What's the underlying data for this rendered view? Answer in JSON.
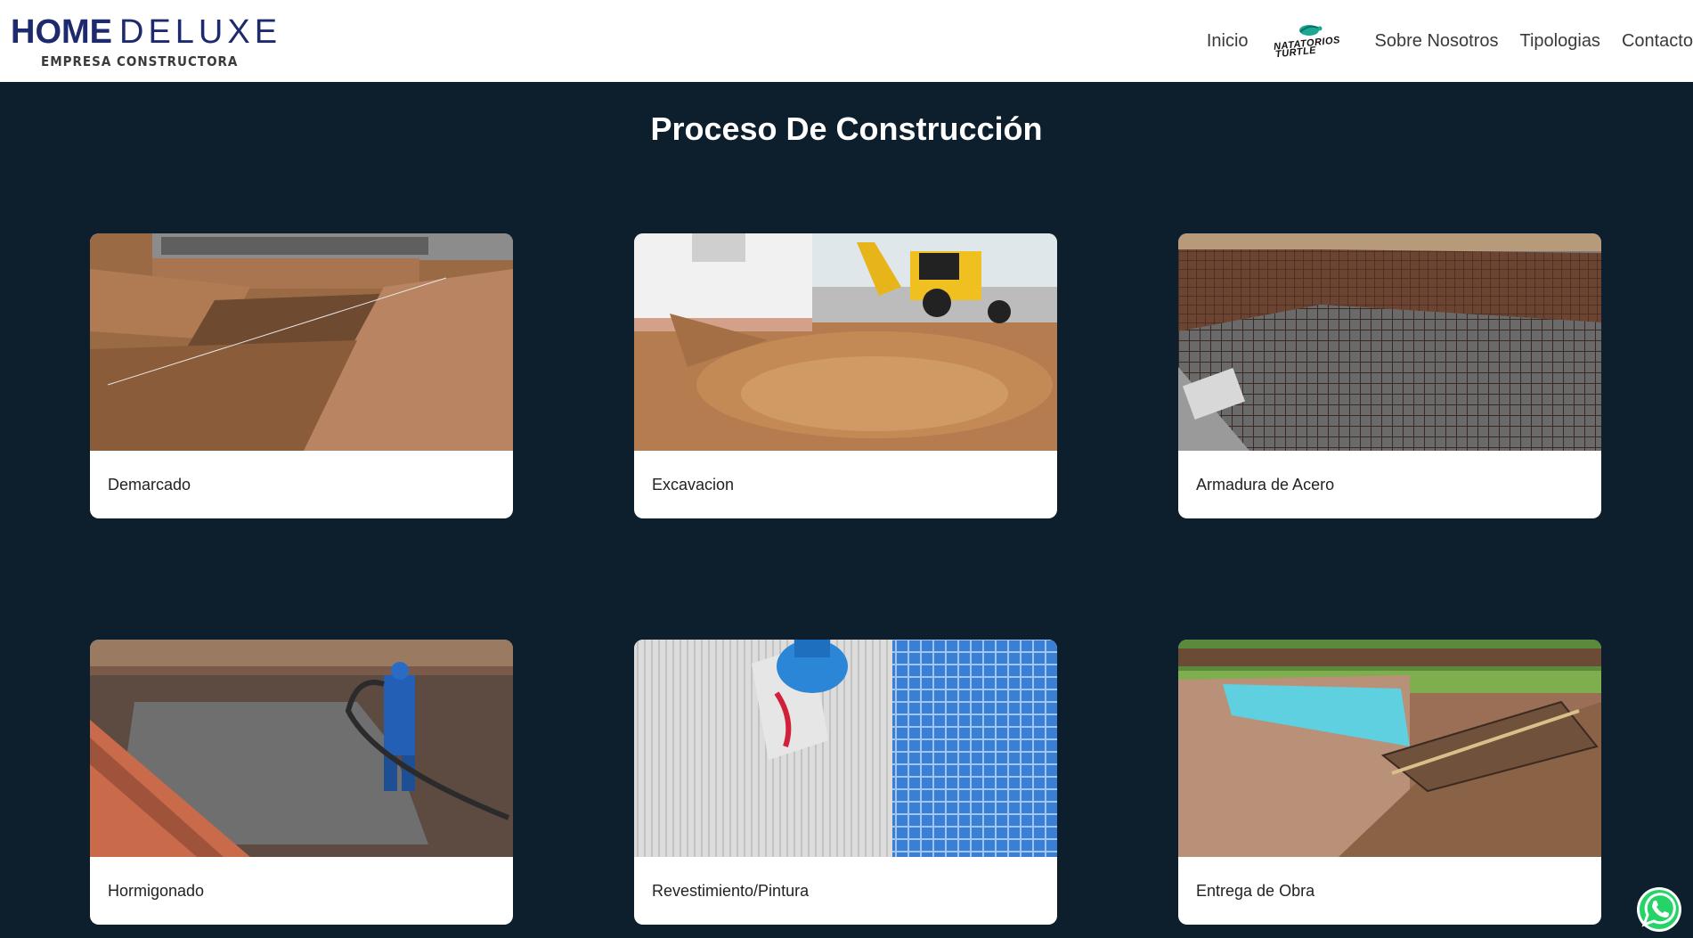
{
  "brand": {
    "logo_main_bold": "HOME",
    "logo_main_light": "DELUXE",
    "logo_sub": "EMPRESA CONSTRUCTORA"
  },
  "nav": {
    "inicio": "Inicio",
    "partner_line1": "NATATORIOS",
    "partner_line2": "TURTLE",
    "sobre": "Sobre Nosotros",
    "tipologias": "Tipologias",
    "contacto": "Contacto"
  },
  "section": {
    "title": "Proceso De Construcción"
  },
  "cards": [
    {
      "label": "Demarcado"
    },
    {
      "label": "Excavacion"
    },
    {
      "label": "Armadura de Acero"
    },
    {
      "label": "Hormigonado"
    },
    {
      "label": "Revestimiento/Pintura"
    },
    {
      "label": "Entrega de Obra"
    }
  ],
  "colors": {
    "background": "#0d1f2d",
    "navbar": "#ffffff",
    "logo": "#1e2a6e",
    "whatsapp": "#25d366"
  },
  "icons": {
    "whatsapp": "whatsapp-icon",
    "partner_logo": "turtle-icon"
  }
}
